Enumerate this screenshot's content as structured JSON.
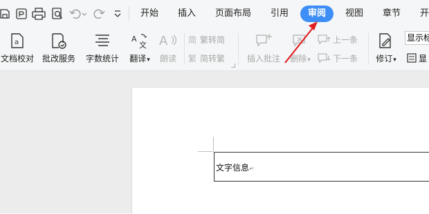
{
  "tabs": [
    {
      "label": "开始"
    },
    {
      "label": "插入"
    },
    {
      "label": "页面布局"
    },
    {
      "label": "引用"
    },
    {
      "label": "审阅",
      "active": true
    },
    {
      "label": "视图"
    },
    {
      "label": "章节"
    },
    {
      "label": "开"
    }
  ],
  "ribbon": {
    "doc_check": "文档校对",
    "revise_service": "批改服务",
    "word_count": "字数统计",
    "translate": "翻译",
    "read_aloud": "朗读",
    "trad_to_simp": "繁转简",
    "simp_to_trad": "简转繁",
    "insert_comment": "插入批注",
    "delete": "删除",
    "prev_item": "上一条",
    "next_item": "下一条",
    "track_changes": "修订",
    "show_markup": "显示标",
    "fourth_option": "显"
  },
  "document": {
    "text": "文字信息"
  },
  "colors": {
    "accent": "#3d8ef7",
    "annotation_arrow": "#e02020",
    "disabled_text": "#a9a9a9"
  }
}
